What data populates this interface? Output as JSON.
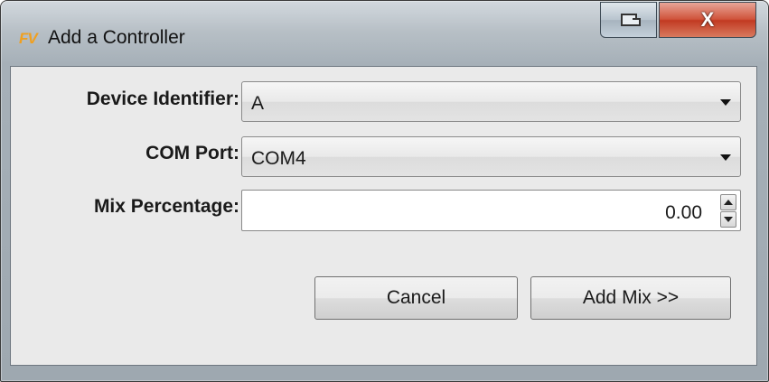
{
  "window": {
    "title": "Add a Controller",
    "app_icon_text": "FV",
    "close_glyph": "X"
  },
  "form": {
    "device_identifier": {
      "label": "Device Identifier:",
      "value": "A"
    },
    "com_port": {
      "label": "COM Port:",
      "value": "COM4"
    },
    "mix_percentage": {
      "label": "Mix Percentage:",
      "value": "0.00"
    }
  },
  "buttons": {
    "cancel_label": "Cancel",
    "add_mix_label": "Add Mix >>"
  },
  "colors": {
    "close_button": "#c8452c",
    "app_icon": "#f0a020",
    "client_background": "#eaeaea"
  },
  "icons": {
    "app": "fv-logo-icon",
    "restore": "restore-window-icon",
    "close": "close-icon",
    "dropdown": "chevron-down-icon",
    "spin_up": "spin-up-icon",
    "spin_down": "spin-down-icon"
  }
}
